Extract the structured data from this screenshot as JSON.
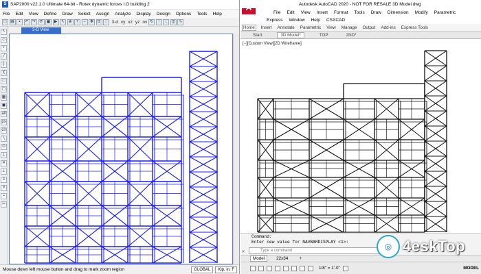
{
  "sap": {
    "title": "SAP2000 v22.1.0 Ultimate 64-bit - Rotex dynamic forces I.O building 2",
    "menu": [
      "File",
      "Edit",
      "View",
      "Define",
      "Draw",
      "Select",
      "Assign",
      "Analyze",
      "Display",
      "Design",
      "Options",
      "Tools",
      "Help"
    ],
    "toolbar_text": [
      "3-d",
      "xy",
      "xz",
      "yz",
      "nv"
    ],
    "view_tab": "3-D View",
    "status_message": "Mouse down left mouse button and drag to mark zoom region",
    "coord_system": "GLOBAL",
    "units": "Kip, in, F",
    "structure_color": "#1a1aff"
  },
  "acad": {
    "title": "Autodesk AutoCAD 2020 - NOT FOR RESALE  3D Model.dwg",
    "menu1": [
      "File",
      "Edit",
      "View",
      "Insert",
      "Format",
      "Tools",
      "Draw",
      "Dimension",
      "Modify",
      "Parametric"
    ],
    "menu2": [
      "Express",
      "Window",
      "Help",
      "CSXCAD"
    ],
    "ribbon_tabs": [
      "Home",
      "Insert",
      "Annotate",
      "Parametric",
      "View",
      "Manage",
      "Output",
      "Add-ins",
      "Express Tools"
    ],
    "file_tabs": [
      "Start",
      "3D Model*",
      "TOP",
      "2ND*"
    ],
    "view_label": "[−][Custom View][2D Wireframe]",
    "command_label": "Command:",
    "command_prompt": "Enter new value for NAVBARDISPLAY <1>:",
    "command_placeholder": "Type a command",
    "bottom_tabs": [
      "Model",
      "22x34"
    ],
    "scale": "1/8\" = 1'-0\"",
    "mode": "MODEL",
    "structure_color": "#111111"
  },
  "watermark": {
    "text": "4eskTop"
  }
}
